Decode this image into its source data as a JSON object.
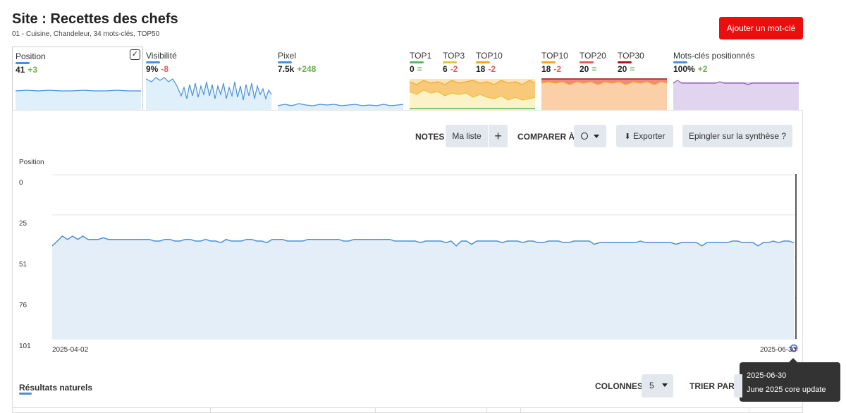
{
  "header": {
    "title": "Site : Recettes des chefs",
    "subtitle": "01 - Cuisine, Chandeleur, 34 mots-clés, TOP50",
    "add_button": "Ajouter un mot-clé"
  },
  "metrics": {
    "position": {
      "label": "Position",
      "value": "41",
      "delta": "+3"
    },
    "visibility": {
      "label": "Visibilité",
      "value": "9%",
      "delta": "-8"
    },
    "pixel": {
      "label": "Pixel",
      "value": "7.5k",
      "delta": "+248"
    },
    "top1": {
      "label": "TOP1",
      "value": "0",
      "delta": "="
    },
    "top3": {
      "label": "TOP3",
      "value": "6",
      "delta": "-2"
    },
    "top10a": {
      "label": "TOP10",
      "value": "18",
      "delta": "-2"
    },
    "top10b": {
      "label": "TOP10",
      "value": "18",
      "delta": "-2"
    },
    "top20": {
      "label": "TOP20",
      "value": "20",
      "delta": "="
    },
    "top30": {
      "label": "TOP30",
      "value": "20",
      "delta": "="
    },
    "positioned": {
      "label": "Mots-clés positionnés",
      "value": "100%",
      "delta": "+2"
    }
  },
  "toolbar": {
    "notes_label": "NOTES",
    "my_list": "Ma liste",
    "add_symbol": "+",
    "compare_label": "COMPARER À",
    "export": "Exporter",
    "pin": "Epingler sur la synthèse ?"
  },
  "chart_data": {
    "type": "area",
    "ylabel": "Position",
    "y_ticks": [
      "0",
      "25",
      "51",
      "76",
      "101"
    ],
    "ylim": [
      101,
      0
    ],
    "y_inverted": true,
    "x_start": "2025-04-02",
    "x_end": "2025-06-30",
    "x_tick_labels": [
      "2025-04-02",
      "2025-06-30"
    ],
    "series": [
      {
        "values": [
          44,
          41,
          38,
          40,
          38,
          40,
          38,
          40,
          40,
          40,
          39,
          40,
          40,
          40,
          40,
          40,
          40,
          40,
          40,
          40,
          41,
          41,
          40,
          40,
          41,
          41,
          40,
          40,
          41,
          41,
          40,
          41,
          41,
          42,
          40,
          41,
          41,
          41,
          40,
          40,
          41,
          41,
          42,
          40,
          40,
          40,
          41,
          41,
          41,
          41,
          40,
          40,
          40,
          40,
          40,
          40,
          40,
          41,
          41,
          40,
          40,
          40,
          40,
          40,
          40,
          40,
          40,
          41,
          41,
          41,
          41,
          41,
          42,
          41,
          41,
          41,
          41,
          42,
          41,
          44,
          41,
          41,
          43,
          41,
          41,
          41,
          41,
          41,
          42,
          41,
          41,
          41,
          42,
          41,
          41,
          42,
          42,
          41,
          41,
          41,
          42,
          42,
          41,
          41,
          41,
          41,
          43,
          42,
          42,
          42,
          42,
          42,
          42,
          42,
          42,
          41,
          42,
          42,
          42,
          42,
          42,
          42,
          43,
          42,
          42,
          42,
          42,
          44,
          42,
          42,
          42,
          42,
          42,
          41,
          41,
          42,
          42,
          42,
          44,
          42,
          42,
          41,
          42,
          41,
          41,
          42
        ]
      }
    ],
    "grid": true
  },
  "tooltip": {
    "date": "2025-06-30",
    "event": "June 2025 core update"
  },
  "results": {
    "title": "Résultats naturels",
    "columns_label": "COLONNES",
    "columns_value": "5",
    "sort_label": "TRIER PAR"
  },
  "colors": {
    "position": "#4a90d9",
    "top1": "#5cb85c",
    "top3": "#e8c23a",
    "top10": "#f5a623",
    "top20": "#e15c5c",
    "top30": "#a31a1a",
    "positioned": "#9b59b6",
    "add_button": "#ee0d0d"
  }
}
